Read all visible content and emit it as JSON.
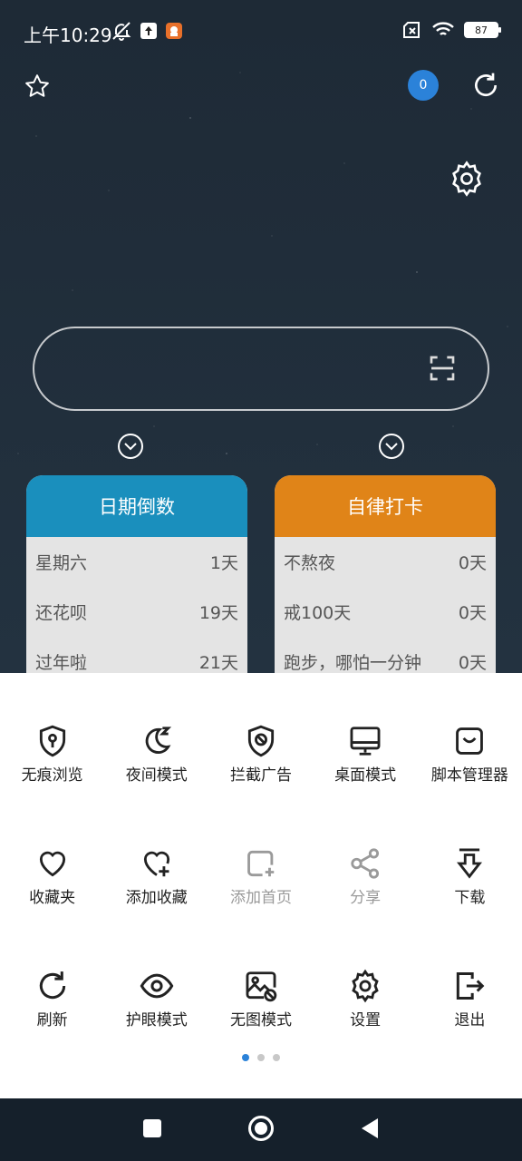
{
  "status": {
    "time": "上午10:29",
    "battery": "87"
  },
  "top": {
    "badge_count": "0"
  },
  "search": {
    "placeholder": ""
  },
  "cards": {
    "countdown": {
      "title": "日期倒数",
      "color": "#1a8fbd",
      "rows": [
        {
          "label": "星期六",
          "value": "1天"
        },
        {
          "label": "还花呗",
          "value": "19天"
        },
        {
          "label": "过年啦",
          "value": "21天"
        }
      ]
    },
    "checkin": {
      "title": "自律打卡",
      "color": "#e08418",
      "rows": [
        {
          "label": "不熬夜",
          "value": "0天"
        },
        {
          "label": "戒100天",
          "value": "0天"
        },
        {
          "label": "跑步，哪怕一分钟",
          "value": "0天"
        }
      ]
    }
  },
  "menu": {
    "items": [
      {
        "label": "无痕浏览",
        "icon": "incognito-shield-icon"
      },
      {
        "label": "夜间模式",
        "icon": "moon-icon"
      },
      {
        "label": "拦截广告",
        "icon": "ad-block-shield-icon"
      },
      {
        "label": "桌面模式",
        "icon": "desktop-icon"
      },
      {
        "label": "脚本管理器",
        "icon": "script-icon"
      },
      {
        "label": "收藏夹",
        "icon": "heart-icon"
      },
      {
        "label": "添加收藏",
        "icon": "heart-plus-icon"
      },
      {
        "label": "添加首页",
        "icon": "add-home-icon"
      },
      {
        "label": "分享",
        "icon": "share-icon"
      },
      {
        "label": "下载",
        "icon": "download-icon"
      },
      {
        "label": "刷新",
        "icon": "refresh-icon"
      },
      {
        "label": "护眼模式",
        "icon": "eye-icon"
      },
      {
        "label": "无图模式",
        "icon": "no-image-icon"
      },
      {
        "label": "设置",
        "icon": "gear-icon"
      },
      {
        "label": "退出",
        "icon": "exit-icon"
      }
    ],
    "page_count": 3,
    "active_page": 1
  },
  "colors": {
    "accent": "#2b82d9",
    "disabled": "#9a9a9a"
  }
}
